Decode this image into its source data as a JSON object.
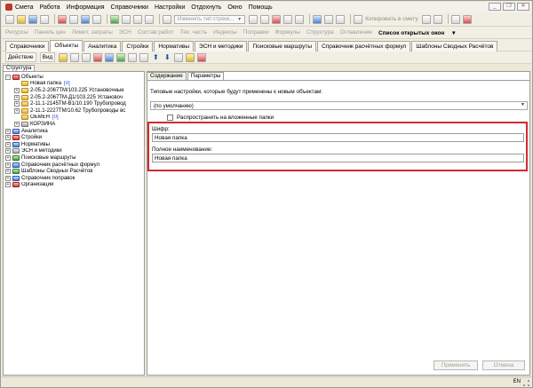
{
  "menu": [
    "Смета",
    "Работа",
    "Информация",
    "Справочники",
    "Настройки",
    "Отдохнуть",
    "Окно",
    "Помощь"
  ],
  "toolbar1": {
    "change_type_label": "Изменить тип строки...",
    "copy_to_estimate_label": "Копировать в смету"
  },
  "toolbar2": [
    "Ресурсы",
    "Панель цен",
    "Лимит. затраты",
    "ЭСН",
    "Состав работ",
    "Тех. часть",
    "Индексы",
    "Поправки",
    "Формулы",
    "Структура",
    "Оглавление"
  ],
  "open_windows_label": "Список открытых окон",
  "main_tabs": [
    "Справочники",
    "Объекты",
    "Аналитика",
    "Стройки",
    "Нормативы",
    "ЭСН и методики",
    "Поисковые маршруты",
    "Справочник расчётных формул",
    "Шаблоны Сводных Расчётов"
  ],
  "action_toolbar": {
    "action_label": "Действие",
    "view_label": "Вид"
  },
  "left_tab": "Структура",
  "tree": {
    "root": "Объекты",
    "new_folder": "Новая папка",
    "new_folder_count": "[0]",
    "children": [
      "2-05.2-2067ТМ/103.225 Установочные",
      "2-05.2-2067ТМ-Д1/103.225 Установоч",
      "2-11.1-2145ТМ-В1/10.190 Трубопровод",
      "2-11.1-2227ТМ/10.62 Трубопроводы вс"
    ],
    "exchange": "ОБМЕН",
    "exchange_count": "[0]",
    "trash": "КОРЗИНА",
    "sections": [
      "Аналитика",
      "Стройки",
      "Нормативы",
      "ЭСН и методики",
      "Поисковые маршруты",
      "Справочник расчётных формул",
      "Шаблоны Сводных Расчётов",
      "Справочник поправок",
      "Организации"
    ]
  },
  "right_tabs": [
    "Содержание",
    "Параметры"
  ],
  "params": {
    "description": "Типовые настройки, которые будут применены к новым объектам:",
    "preset_value": "(по умолчанию)",
    "propagate_label": "Распространить на вложенные папки",
    "code_label": "Шифр:",
    "code_value": "Новая папка",
    "fullname_label": "Полное наименование:",
    "fullname_value": "Новая папка"
  },
  "buttons": {
    "apply": "Применить",
    "cancel": "Отмена"
  },
  "status": {
    "lang": "EN"
  }
}
